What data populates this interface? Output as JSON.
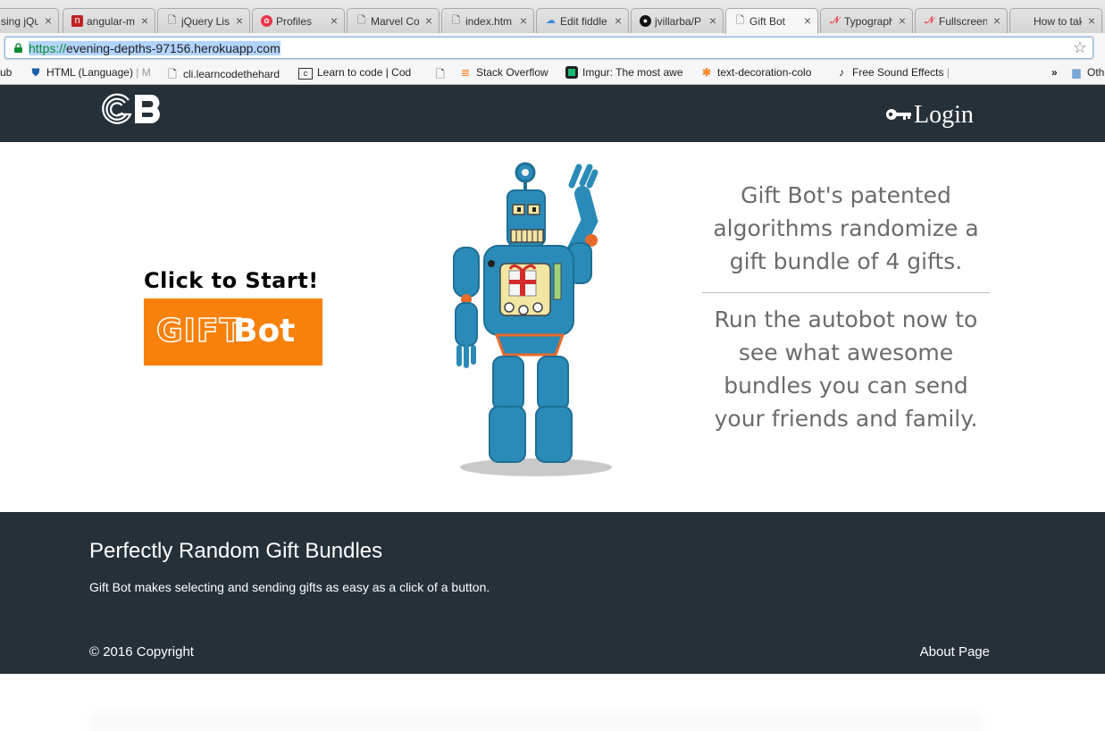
{
  "browser": {
    "tabs": [
      {
        "title": "sing jQu",
        "icon": "page-icon"
      },
      {
        "title": "angular-m",
        "icon": "npm-icon"
      },
      {
        "title": "jQuery Lis",
        "icon": "page-icon"
      },
      {
        "title": "Profiles",
        "icon": "profile-icon"
      },
      {
        "title": "Marvel Co",
        "icon": "page-icon"
      },
      {
        "title": "index.htm",
        "icon": "page-icon"
      },
      {
        "title": "Edit fiddle",
        "icon": "fiddle-icon"
      },
      {
        "title": "jvillarba/P",
        "icon": "github-icon"
      },
      {
        "title": "Gift Bot",
        "icon": "page-icon"
      },
      {
        "title": "Typograph",
        "icon": "typography-icon"
      },
      {
        "title": "Fullscreen",
        "icon": "typography-icon"
      },
      {
        "title": "How to tak",
        "icon": "apple-icon"
      }
    ],
    "active_tab": 8,
    "address": {
      "scheme": "https://",
      "host": "evening-depths-97156.herokuapp.com"
    },
    "bookmarks": [
      {
        "label": "ub",
        "icon": ""
      },
      {
        "label": "HTML (Language)",
        "extra": "| M",
        "icon": "html-icon"
      },
      {
        "label": "cli.learncodethehard",
        "icon": "page-icon"
      },
      {
        "label": "Learn to code | Cod",
        "icon": "codecademy-icon"
      },
      {
        "label": "",
        "icon": "page-icon"
      },
      {
        "label": "Stack Overflow",
        "icon": "stackoverflow-icon"
      },
      {
        "label": "Imgur: The most awe",
        "icon": "imgur-icon"
      },
      {
        "label": "text-decoration-colo",
        "icon": "asterisk-icon"
      },
      {
        "label": "Free Sound Effects",
        "extra": "|",
        "icon": "sound-icon"
      },
      {
        "label": "»",
        "icon": ""
      },
      {
        "label": "Oth",
        "icon": "folder-icon"
      }
    ]
  },
  "header": {
    "logo_text": "GB",
    "login_label": "Login"
  },
  "hero": {
    "cta_label": "Click to Start!",
    "cta_button": {
      "gift": "GIFT",
      "bot": "Bot"
    },
    "copy_1": "Gift Bot's patented algorithms randomize a gift bundle of 4 gifts.",
    "copy_2": "Run the autobot now to see what awesome bundles you can send your friends and family."
  },
  "footer": {
    "title": "Perfectly Random Gift Bundles",
    "text": "Gift Bot makes selecting and sending gifts as easy as a click of a button.",
    "copyright": "© 2016 Copyright",
    "about_link": "About Page"
  },
  "colors": {
    "header_bg": "#263039",
    "cta_orange": "#f7810b",
    "robot_blue": "#2b8bb8",
    "text_gray": "#6b6b6b"
  }
}
